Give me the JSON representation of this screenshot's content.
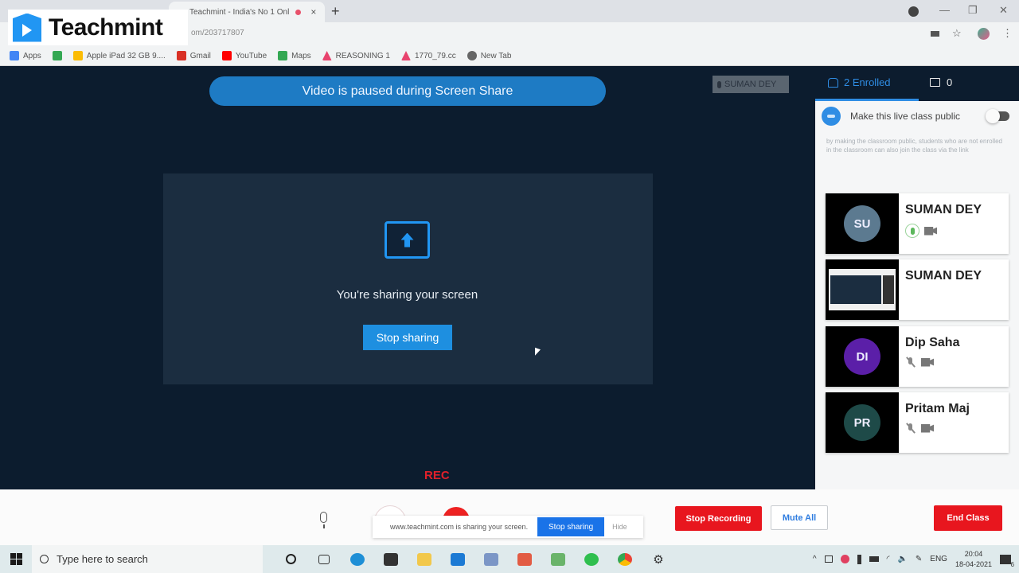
{
  "browser": {
    "tab_title": "Teachmint - India's No 1 Onl",
    "new_tab_symbol": "+",
    "close_tab_symbol": "×",
    "url_fragment": "om/203717807",
    "bookmarks": [
      {
        "label": "Apps",
        "icon": "apps-grid-icon",
        "color": "#4285f4"
      },
      {
        "label": "",
        "icon": "google-drive-icon",
        "color": "#34a853"
      },
      {
        "label": "Apple iPad 32 GB 9....",
        "icon": "bookmark-favicon-icon",
        "color": "#fbbc05"
      },
      {
        "label": "Gmail",
        "icon": "gmail-icon",
        "color": "#d93025"
      },
      {
        "label": "YouTube",
        "icon": "youtube-icon",
        "color": "#ff0000"
      },
      {
        "label": "Maps",
        "icon": "maps-icon",
        "color": "#34a853"
      },
      {
        "label": "REASONING 1",
        "icon": "drive-triangle-icon",
        "color": "#e8436e"
      },
      {
        "label": "1770_79.cc",
        "icon": "drive-triangle-icon",
        "color": "#e8436e"
      },
      {
        "label": "New Tab",
        "icon": "globe-icon",
        "color": "#666666"
      }
    ]
  },
  "logo": {
    "text": "Teachmint",
    "color": "#2196f3"
  },
  "stage": {
    "pause_banner": "Video is paused during Screen Share",
    "speaker_tag": "SUMAN DEY",
    "share_text": "You're sharing your screen",
    "stop_sharing_label": "Stop sharing",
    "rec_label": "REC"
  },
  "sidebar": {
    "enrolled_label": "2 Enrolled",
    "chat_count": "0",
    "public_label": "Make this live class public",
    "public_enabled": false,
    "public_description": "by making the classroom public, students who are not enrolled in the classroom can also join the class via the link",
    "participants": [
      {
        "initials": "SU",
        "name": "SUMAN DEY",
        "avatar_color": "#5c7a90",
        "mic": "on",
        "camera": "off",
        "video": "avatar"
      },
      {
        "initials": "",
        "name": "SUMAN DEY",
        "avatar_color": "",
        "mic": "",
        "camera": "",
        "video": "screen"
      },
      {
        "initials": "DI",
        "name": "Dip Saha",
        "avatar_color": "#5b1fa8",
        "mic": "off",
        "camera": "off",
        "video": "avatar"
      },
      {
        "initials": "PR",
        "name": "Pritam Maj",
        "avatar_color": "#1e4a48",
        "mic": "off",
        "camera": "off",
        "video": "avatar"
      }
    ]
  },
  "controls": {
    "chrome_share_text": "www.teachmint.com is sharing your screen.",
    "chrome_stop_label": "Stop sharing",
    "chrome_hide_label": "Hide",
    "stop_recording_label": "Stop Recording",
    "mute_all_label": "Mute All",
    "end_class_label": "End Class"
  },
  "taskbar": {
    "search_placeholder": "Type here to search",
    "language": "ENG",
    "time": "20:04",
    "date": "18-04-2021",
    "notification_count": "6"
  }
}
